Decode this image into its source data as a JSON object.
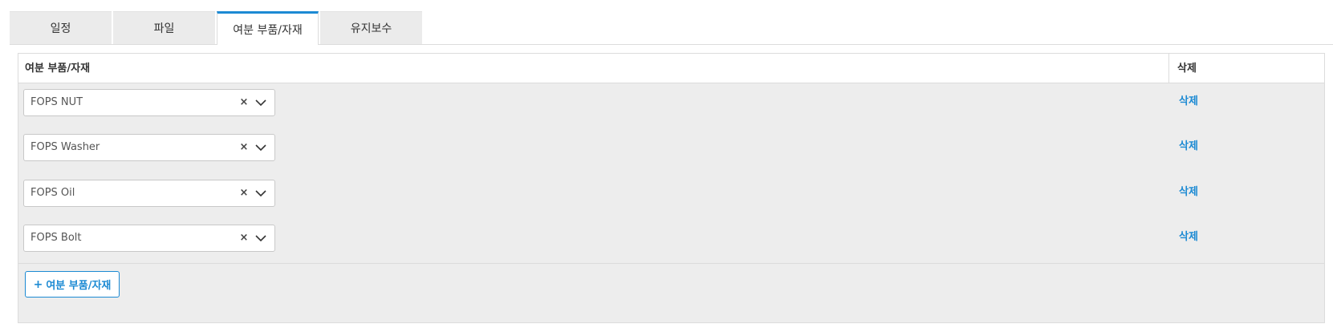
{
  "tabs": [
    {
      "label": "일정",
      "active": false
    },
    {
      "label": "파일",
      "active": false
    },
    {
      "label": "여분 부품/자재",
      "active": true
    },
    {
      "label": "유지보수",
      "active": false
    }
  ],
  "table": {
    "header_name": "여분 부품/자재",
    "header_delete": "삭제",
    "rows": [
      {
        "value": "FOPS NUT",
        "delete_label": "삭제"
      },
      {
        "value": "FOPS Washer",
        "delete_label": "삭제"
      },
      {
        "value": "FOPS Oil",
        "delete_label": "삭제"
      },
      {
        "value": "FOPS Bolt",
        "delete_label": "삭제"
      }
    ]
  },
  "add_button": {
    "icon": "plus-icon",
    "label": "여분 부품/자재"
  },
  "icons": {
    "clear": "close-icon",
    "dropdown": "chevron-down-icon"
  },
  "colors": {
    "accent": "#1c8ad3",
    "panel_bg": "#ededed"
  }
}
